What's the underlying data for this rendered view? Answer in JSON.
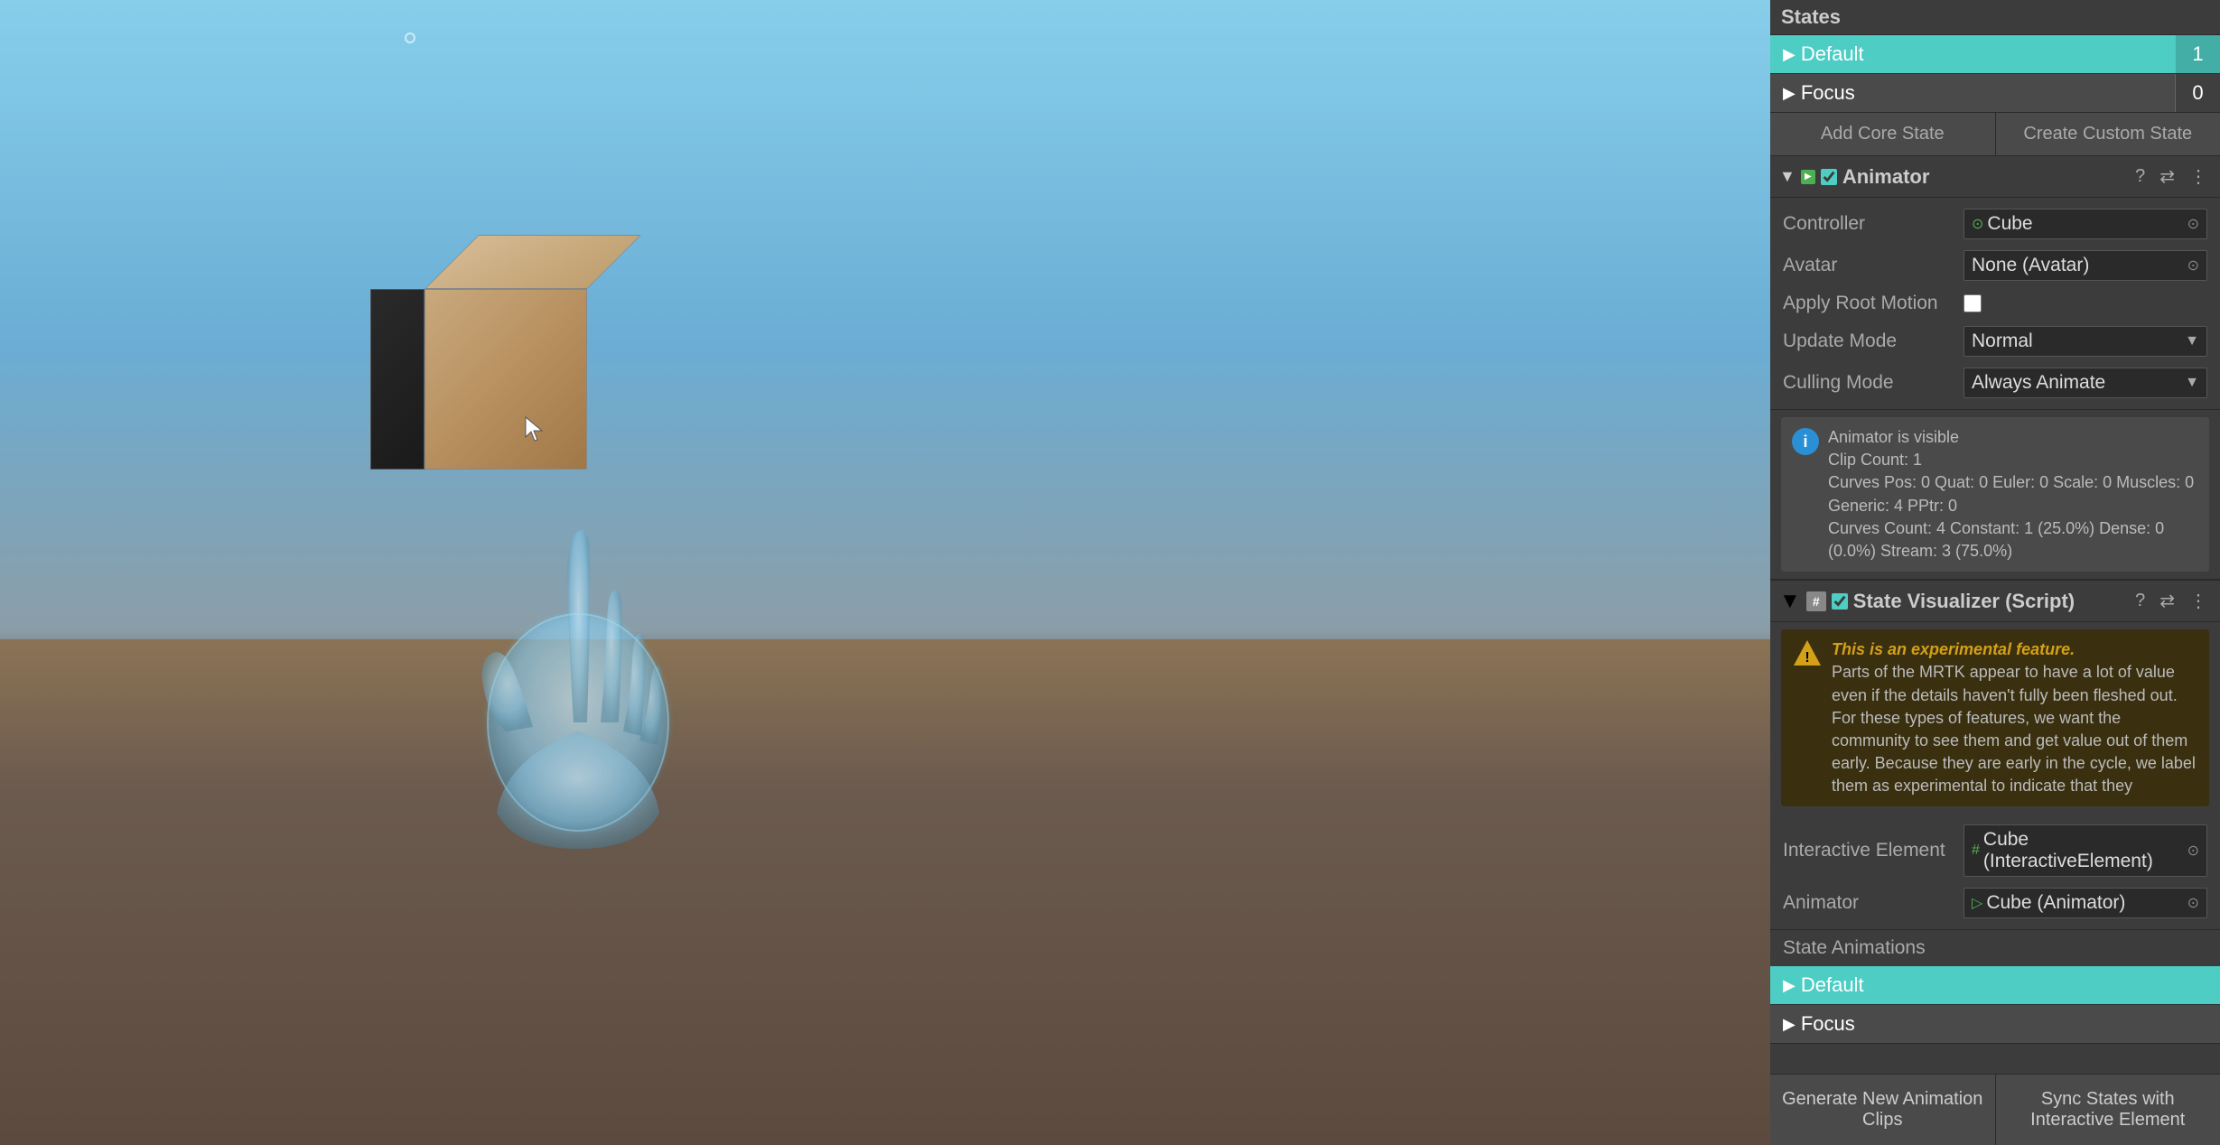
{
  "viewport": {
    "background": "3D scene with cube and hand"
  },
  "right_panel": {
    "states_section": {
      "title": "States",
      "default_state": {
        "label": "Default",
        "count": "1"
      },
      "focus_state": {
        "label": "Focus",
        "count": "0"
      },
      "add_core_btn": "Add Core State",
      "create_custom_btn": "Create Custom State"
    },
    "animator_component": {
      "title": "Animator",
      "enabled": true,
      "controller_label": "Controller",
      "controller_value": "Cube",
      "controller_icon": "⊙",
      "avatar_label": "Avatar",
      "avatar_value": "None (Avatar)",
      "avatar_icon": "⊙",
      "apply_root_motion_label": "Apply Root Motion",
      "update_mode_label": "Update Mode",
      "update_mode_value": "Normal",
      "culling_mode_label": "Culling Mode",
      "culling_mode_value": "Always Animate",
      "info_text": "Animator is visible\nClip Count: 1\nCurves Pos: 0 Quat: 0 Euler: 0 Scale: 0 Muscles: 0 Generic: 4 PPtr: 0\nCurves Count: 4 Constant: 1 (25.0%) Dense: 0 (0.0%) Stream: 3 (75.0%)"
    },
    "state_visualizer": {
      "title": "State Visualizer (Script)",
      "enabled": true,
      "experimental_title": "This is an experimental feature.",
      "experimental_body": "Parts of the MRTK appear to have a lot of value even if the details haven't fully been fleshed out. For these types of features, we want the community to see them and get value out of them early. Because they are early in the cycle, we label them as experimental to indicate that they",
      "interactive_element_label": "Interactive Element",
      "interactive_element_value": "Cube (InteractiveElement)",
      "interactive_element_icon": "#",
      "animator_label": "Animator",
      "animator_value": "Cube (Animator)",
      "animator_icon": "▷",
      "state_animations_label": "State Animations",
      "default_state": {
        "label": "Default"
      },
      "focus_state": {
        "label": "Focus"
      },
      "generate_btn": "Generate New Animation Clips",
      "sync_btn": "Sync States with Interactive Element"
    }
  }
}
